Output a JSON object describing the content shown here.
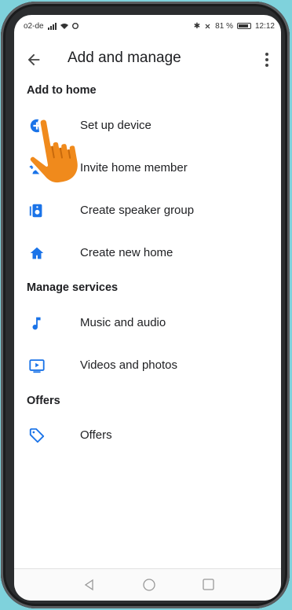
{
  "status_bar": {
    "carrier": "o2-de",
    "battery": "81 %",
    "time": "12:12"
  },
  "header": {
    "title": "Add and manage"
  },
  "sections": [
    {
      "title": "Add to home",
      "items": [
        {
          "label": "Set up device",
          "icon": "add-circle-icon"
        },
        {
          "label": "Invite home member",
          "icon": "person-add-icon"
        },
        {
          "label": "Create speaker group",
          "icon": "speaker-icon"
        },
        {
          "label": "Create new home",
          "icon": "home-icon"
        }
      ]
    },
    {
      "title": "Manage services",
      "items": [
        {
          "label": "Music and audio",
          "icon": "music-note-icon"
        },
        {
          "label": "Videos and photos",
          "icon": "video-icon"
        }
      ]
    },
    {
      "title": "Offers",
      "items": [
        {
          "label": "Offers",
          "icon": "tag-icon"
        }
      ]
    }
  ],
  "colors": {
    "accent": "#1a73e8",
    "background": "#7fd2dc",
    "hand": "#f08a1c"
  }
}
